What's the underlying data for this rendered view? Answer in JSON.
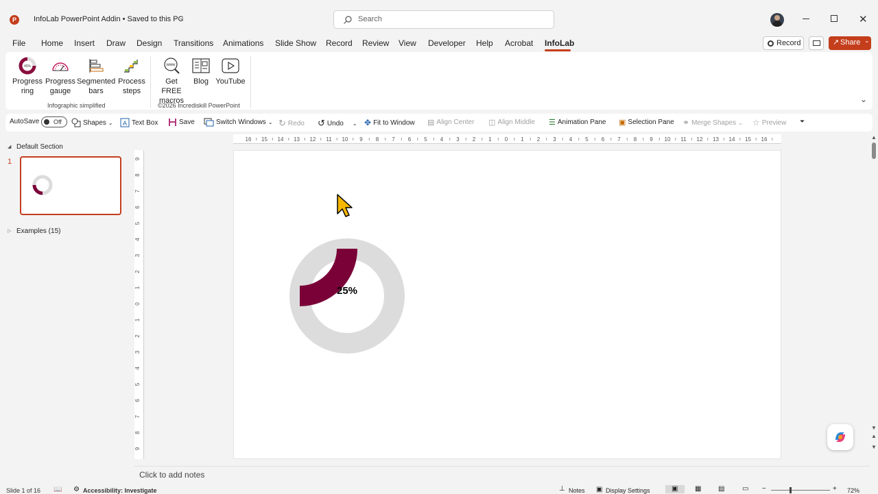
{
  "window": {
    "title": "InfoLab PowerPoint Addin • Saved to this PC",
    "search_placeholder": "Search"
  },
  "menu_tabs": [
    "File",
    "Home",
    "Insert",
    "Draw",
    "Design",
    "Transitions",
    "Animations",
    "Slide Show",
    "Record",
    "Review",
    "View",
    "Developer",
    "Help",
    "Acrobat",
    "InfoLab"
  ],
  "active_tab": "InfoLab",
  "header_actions": {
    "record": "Record",
    "share": "Share"
  },
  "ribbon": {
    "group1": {
      "label": "Infographic simplified",
      "buttons": [
        {
          "l1": "Progress",
          "l2": "ring"
        },
        {
          "l1": "Progress",
          "l2": "gauge"
        },
        {
          "l1": "Segmented",
          "l2": "bars"
        },
        {
          "l1": "Process",
          "l2": "steps"
        }
      ]
    },
    "group2": {
      "label": "©2026 Incrediskill PowerPoint",
      "buttons": [
        {
          "l1": "Get FREE",
          "l2": "macros"
        },
        {
          "l1": "Blog",
          "l2": ""
        },
        {
          "l1": "YouTube",
          "l2": ""
        }
      ]
    }
  },
  "qat": {
    "autosave": "AutoSave",
    "autosave_state": "Off",
    "shapes": "Shapes",
    "textbox": "Text Box",
    "save": "Save",
    "switch_windows": "Switch Windows",
    "redo": "Redo",
    "undo": "Undo",
    "fit": "Fit to Window",
    "align_center": "Align Center",
    "align_middle": "Align Middle",
    "animation_pane": "Animation Pane",
    "selection_pane": "Selection Pane",
    "merge_shapes": "Merge Shapes",
    "preview": "Preview"
  },
  "slides_pane": {
    "section": "Default Section",
    "slide_number": "1",
    "examples": "Examples (15)"
  },
  "ruler_h": [
    "16",
    "15",
    "14",
    "13",
    "12",
    "11",
    "10",
    "9",
    "8",
    "7",
    "6",
    "5",
    "4",
    "3",
    "2",
    "1",
    "0",
    "1",
    "2",
    "3",
    "4",
    "5",
    "6",
    "7",
    "8",
    "9",
    "10",
    "11",
    "12",
    "13",
    "14",
    "15",
    "16"
  ],
  "ruler_v": [
    "9",
    "8",
    "7",
    "6",
    "5",
    "4",
    "3",
    "2",
    "1",
    "0",
    "1",
    "2",
    "3",
    "4",
    "5",
    "6",
    "7",
    "8",
    "9"
  ],
  "slide": {
    "ring_percent": 0.25,
    "ring_label": "25%",
    "ring_color": "#7a0038",
    "track_color": "#dcdcdc"
  },
  "notes_placeholder": "Click to add notes",
  "status": {
    "slide_info": "Slide 1 of 16",
    "accessibility": "Accessibility: Investigate",
    "notes": "Notes",
    "display": "Display Settings",
    "zoom": "72%"
  },
  "colors": {
    "accent": "#c43e1c",
    "share_bg": "#c43e1c"
  }
}
